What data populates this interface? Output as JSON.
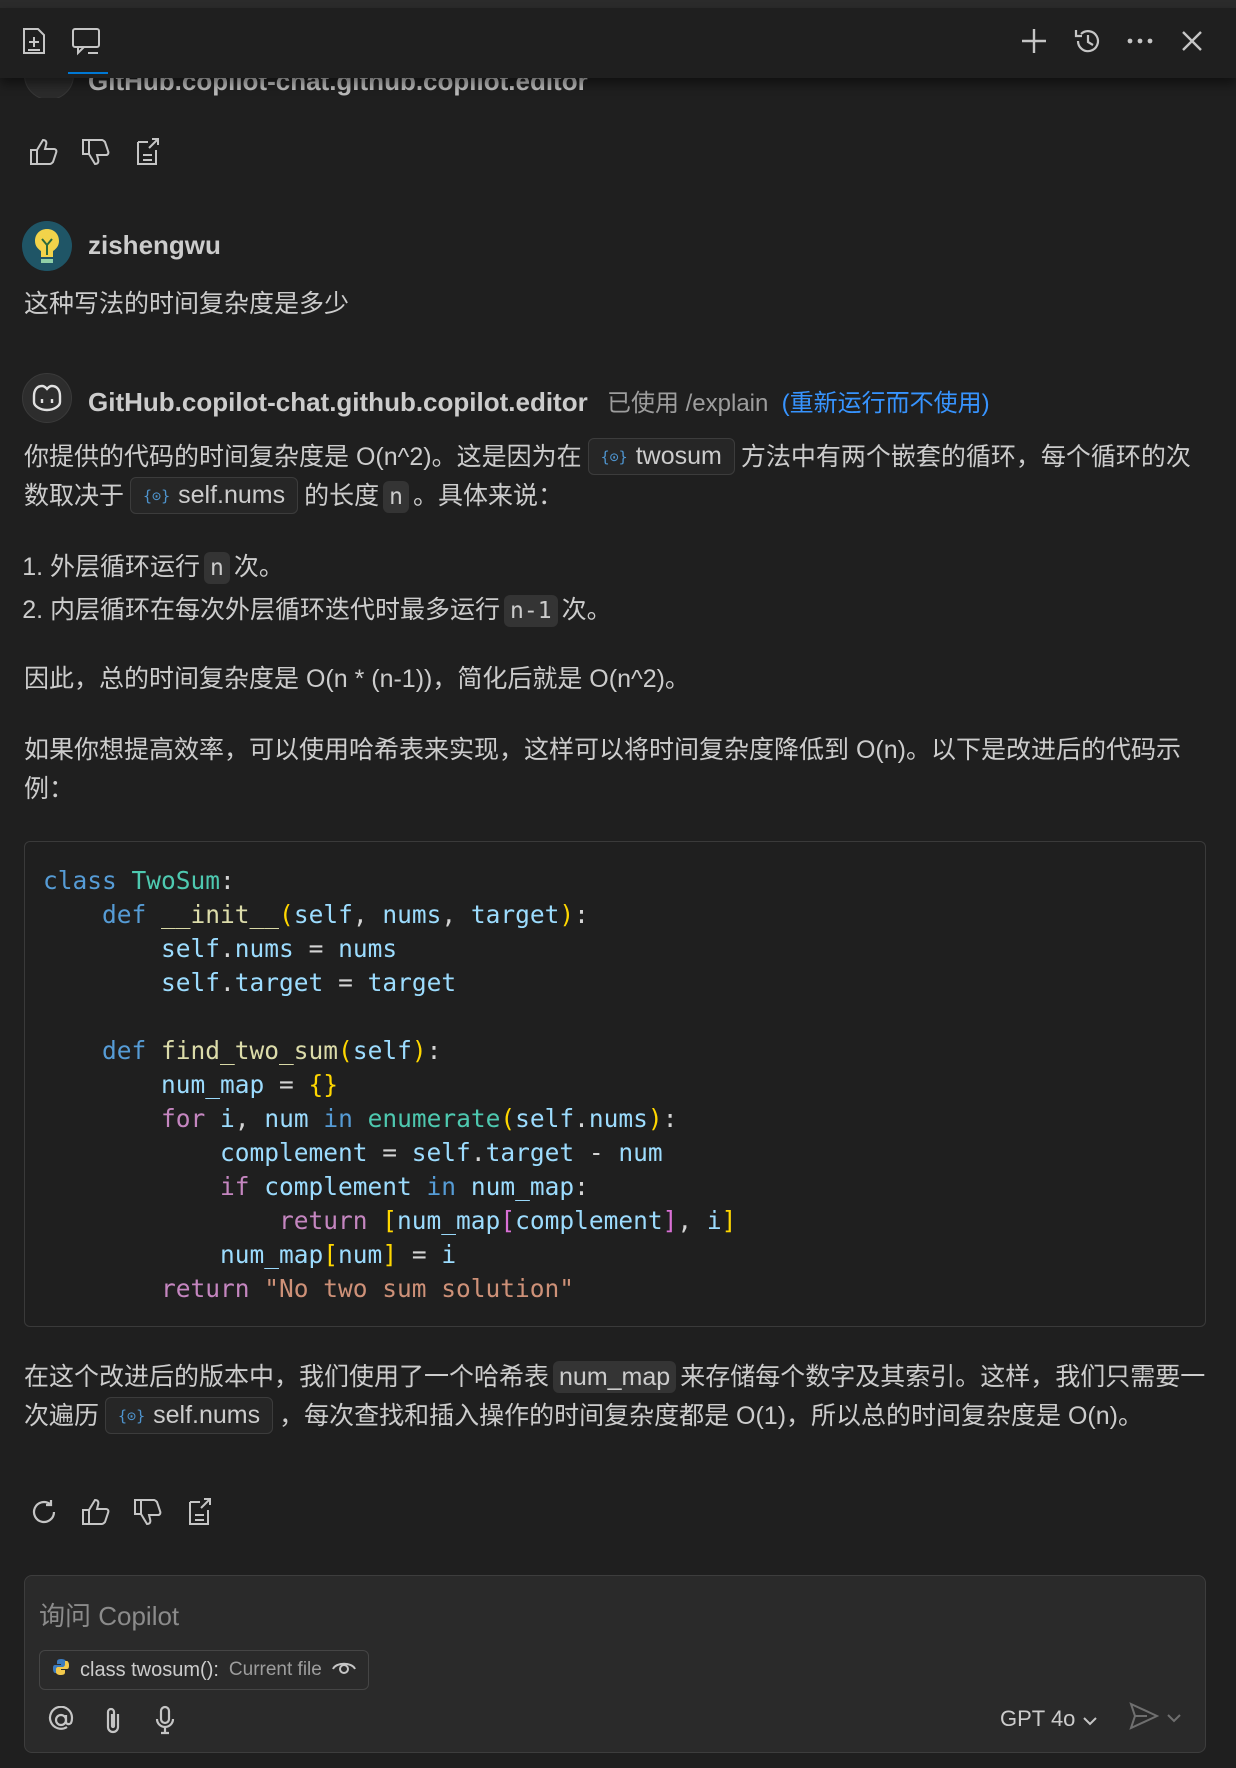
{
  "ghost": {
    "name": "GitHub.copilot-chat.github.copilot.editor"
  },
  "user": {
    "name": "zishengwu",
    "question": "这种写法的时间复杂度是多少"
  },
  "assistant": {
    "name": "GitHub.copilot-chat.github.copilot.editor",
    "used_text": "已使用 /explain",
    "rerun_link": "(重新运行而不使用)",
    "p1": {
      "a": "你提供的代码的时间复杂度是 O(n^2)。这是因为在",
      "ref1": "twosum",
      "b": "方法中有两个嵌套的循环，每个循环的次数取决于",
      "ref2": "self.nums",
      "c": "的长度",
      "code": "n",
      "d": "。具体来说："
    },
    "steps": [
      {
        "a": "外层循环运行",
        "code": "n",
        "b": "次。"
      },
      {
        "a": "内层循环在每次外层循环迭代时最多运行",
        "code": "n-1",
        "b": "次。"
      }
    ],
    "p2": "因此，总的时间复杂度是 O(n * (n-1))，简化后就是 O(n^2)。",
    "p3": "如果你想提高效率，可以使用哈希表来实现，这样可以将时间复杂度降低到 O(n)。以下是改进后的代码示例：",
    "p4": {
      "a": "在这个改进后的版本中，我们使用了一个哈希表",
      "code": "num_map",
      "b": "来存储每个数字及其索引。这样，我们只需要一次遍历",
      "ref": "self.nums",
      "c": "，每次查找和插入操作的时间复杂度都是 O(1)，所以总的时间复杂度是 O(n)。"
    },
    "code_lines": [
      [
        [
          "kw",
          "class "
        ],
        [
          "cls",
          "TwoSum"
        ],
        [
          "op",
          ":"
        ]
      ],
      [
        [
          "prefix",
          "    "
        ],
        [
          "kw",
          "def "
        ],
        [
          "fn",
          "__init__"
        ],
        [
          "br",
          "("
        ],
        [
          "var",
          "self"
        ],
        [
          "op",
          ", "
        ],
        [
          "var",
          "nums"
        ],
        [
          "op",
          ", "
        ],
        [
          "var",
          "target"
        ],
        [
          "br",
          ")"
        ],
        [
          "op",
          ":"
        ]
      ],
      [
        [
          "prefix",
          "        "
        ],
        [
          "var",
          "self"
        ],
        [
          "op",
          "."
        ],
        [
          "var",
          "nums"
        ],
        [
          "op",
          " = "
        ],
        [
          "var",
          "nums"
        ]
      ],
      [
        [
          "prefix",
          "        "
        ],
        [
          "var",
          "self"
        ],
        [
          "op",
          "."
        ],
        [
          "var",
          "target"
        ],
        [
          "op",
          " = "
        ],
        [
          "var",
          "target"
        ]
      ],
      [
        [
          "prefix",
          " "
        ]
      ],
      [
        [
          "prefix",
          "    "
        ],
        [
          "kw",
          "def "
        ],
        [
          "fn",
          "find_two_sum"
        ],
        [
          "br",
          "("
        ],
        [
          "var",
          "self"
        ],
        [
          "br",
          ")"
        ],
        [
          "op",
          ":"
        ]
      ],
      [
        [
          "prefix",
          "        "
        ],
        [
          "var",
          "num_map"
        ],
        [
          "op",
          " = "
        ],
        [
          "br",
          "{}"
        ]
      ],
      [
        [
          "prefix",
          "        "
        ],
        [
          "kw2",
          "for "
        ],
        [
          "var",
          "i"
        ],
        [
          "op",
          ", "
        ],
        [
          "var",
          "num"
        ],
        [
          "kw",
          " in "
        ],
        [
          "bi",
          "enumerate"
        ],
        [
          "br",
          "("
        ],
        [
          "var",
          "self"
        ],
        [
          "op",
          "."
        ],
        [
          "var",
          "nums"
        ],
        [
          "br",
          ")"
        ],
        [
          "op",
          ":"
        ]
      ],
      [
        [
          "prefix",
          "            "
        ],
        [
          "var",
          "complement"
        ],
        [
          "op",
          " = "
        ],
        [
          "var",
          "self"
        ],
        [
          "op",
          "."
        ],
        [
          "var",
          "target"
        ],
        [
          "op",
          " - "
        ],
        [
          "var",
          "num"
        ]
      ],
      [
        [
          "prefix",
          "            "
        ],
        [
          "kw2",
          "if "
        ],
        [
          "var",
          "complement"
        ],
        [
          "kw",
          " in "
        ],
        [
          "var",
          "num_map"
        ],
        [
          "op",
          ":"
        ]
      ],
      [
        [
          "prefix",
          "                "
        ],
        [
          "kw2",
          "return "
        ],
        [
          "br",
          "["
        ],
        [
          "var",
          "num_map"
        ],
        [
          "br2",
          "["
        ],
        [
          "var",
          "complement"
        ],
        [
          "br2",
          "]"
        ],
        [
          "op",
          ", "
        ],
        [
          "var",
          "i"
        ],
        [
          "br",
          "]"
        ]
      ],
      [
        [
          "prefix",
          "            "
        ],
        [
          "var",
          "num_map"
        ],
        [
          "br",
          "["
        ],
        [
          "var",
          "num"
        ],
        [
          "br",
          "]"
        ],
        [
          "op",
          " = "
        ],
        [
          "var",
          "i"
        ]
      ],
      [
        [
          "prefix",
          "        "
        ],
        [
          "kw2",
          "return "
        ],
        [
          "str",
          "\"No two sum solution\""
        ]
      ]
    ]
  },
  "input": {
    "placeholder": "询问 Copilot",
    "chip_label": "class twosum():",
    "chip_sub": "Current file",
    "model": "GPT 4o"
  },
  "colors": {
    "background": "#1f1f1f",
    "accent": "#0078d4",
    "link": "#3794ff"
  }
}
